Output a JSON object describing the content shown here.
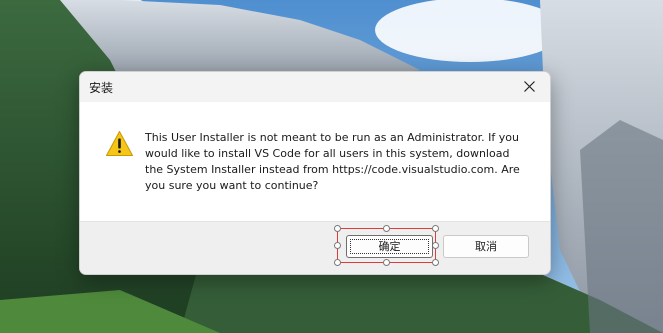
{
  "background": {
    "type": "mountain-landscape-wallpaper"
  },
  "dialog": {
    "title": "安装",
    "icon": "warning-triangle-icon",
    "message": "This User Installer is not meant to be run as an Administrator. If you would like to install VS Code for all users in this system, download the System Installer instead from https://code.visualstudio.com. Are you sure you want to continue?",
    "buttons": {
      "ok_label": "确定",
      "cancel_label": "取消"
    }
  },
  "colors": {
    "warning": "#f5c518",
    "selection_outline": "#e03b3b"
  }
}
